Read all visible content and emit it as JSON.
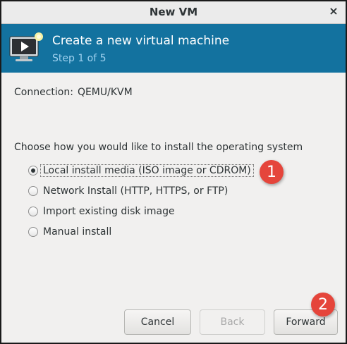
{
  "window": {
    "title": "New VM",
    "close_glyph": "×"
  },
  "header": {
    "icon": "vm-monitor-icon",
    "title": "Create a new virtual machine",
    "step": "Step 1 of 5"
  },
  "connection": {
    "label": "Connection:",
    "value": "QEMU/KVM"
  },
  "install": {
    "prompt": "Choose how you would like to install the operating system",
    "options": [
      {
        "label": "Local install media (ISO image or CDROM)",
        "selected": true
      },
      {
        "label": "Network Install (HTTP, HTTPS, or FTP)",
        "selected": false
      },
      {
        "label": "Import existing disk image",
        "selected": false
      },
      {
        "label": "Manual install",
        "selected": false
      }
    ]
  },
  "buttons": {
    "cancel": "Cancel",
    "back": "Back",
    "forward": "Forward"
  },
  "markers": {
    "one": "1",
    "two": "2"
  },
  "colors": {
    "banner": "#13729f",
    "step_text": "#9fd1ef",
    "marker": "#e5453b"
  }
}
